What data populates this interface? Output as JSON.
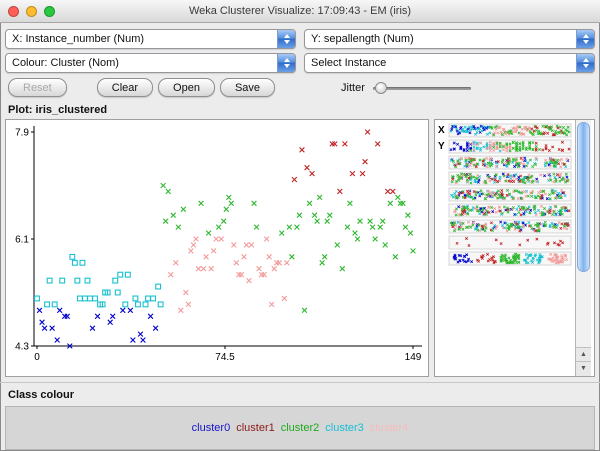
{
  "window": {
    "title": "Weka Clusterer Visualize: 17:09:43 - EM (iris)"
  },
  "controls": {
    "x_select": "X: Instance_number (Num)",
    "y_select": "Y: sepallength (Num)",
    "colour_select": "Colour: Cluster (Nom)",
    "instance_select": "Select Instance",
    "reset_label": "Reset",
    "clear_label": "Clear",
    "open_label": "Open",
    "save_label": "Save",
    "jitter_label": "Jitter"
  },
  "plot": {
    "label": "Plot: iris_clustered"
  },
  "attribute_panel": {
    "x_marker": "X",
    "y_marker": "Y",
    "strip_count": 9
  },
  "legend": {
    "title": "Class colour",
    "items": [
      {
        "label": "cluster0",
        "color": "#1414cc"
      },
      {
        "label": "cluster1",
        "color": "#8b1a1a"
      },
      {
        "label": "cluster2",
        "color": "#1faa1f"
      },
      {
        "label": "cluster3",
        "color": "#19bdd6"
      },
      {
        "label": "cluster4",
        "color": "#f7bcbc"
      }
    ]
  },
  "chart_data": {
    "type": "scatter",
    "title": "iris_clustered",
    "x_attribute": "Instance_number",
    "y_attribute": "sepallength",
    "xlim": [
      0,
      149
    ],
    "ylim": [
      4.3,
      7.9
    ],
    "x_ticks": [
      "0",
      "74.5",
      "149"
    ],
    "y_ticks": [
      "7.9",
      "6.1",
      "4.3"
    ],
    "grid": false,
    "legend_position": "bottom",
    "series": [
      {
        "name": "cluster0",
        "color": "#0000cc",
        "marker": "x",
        "points": [
          [
            1,
            4.9
          ],
          [
            2,
            4.7
          ],
          [
            3,
            4.6
          ],
          [
            6,
            4.6
          ],
          [
            8,
            4.4
          ],
          [
            9,
            4.9
          ],
          [
            11,
            4.8
          ],
          [
            12,
            4.8
          ],
          [
            13,
            4.3
          ],
          [
            22,
            4.6
          ],
          [
            24,
            4.8
          ],
          [
            29,
            4.7
          ],
          [
            30,
            4.8
          ],
          [
            34,
            4.9
          ],
          [
            37,
            4.9
          ],
          [
            38,
            4.4
          ],
          [
            41,
            4.5
          ],
          [
            42,
            4.4
          ],
          [
            45,
            4.8
          ],
          [
            47,
            4.6
          ]
        ]
      },
      {
        "name": "cluster1",
        "color": "#c32222",
        "marker": "x",
        "points": [
          [
            102,
            7.1
          ],
          [
            105,
            7.6
          ],
          [
            107,
            7.3
          ],
          [
            109,
            7.2
          ],
          [
            117,
            7.7
          ],
          [
            118,
            7.7
          ],
          [
            120,
            6.9
          ],
          [
            122,
            7.7
          ],
          [
            125,
            7.2
          ],
          [
            129,
            7.2
          ],
          [
            130,
            7.4
          ],
          [
            131,
            7.9
          ],
          [
            135,
            7.7
          ],
          [
            139,
            6.9
          ],
          [
            141,
            6.9
          ]
        ]
      },
      {
        "name": "cluster2",
        "color": "#2db82d",
        "marker": "x",
        "points": [
          [
            50,
            7.0
          ],
          [
            51,
            6.4
          ],
          [
            52,
            6.9
          ],
          [
            54,
            6.5
          ],
          [
            56,
            6.3
          ],
          [
            58,
            6.6
          ],
          [
            65,
            6.7
          ],
          [
            68,
            6.2
          ],
          [
            72,
            6.3
          ],
          [
            74,
            6.4
          ],
          [
            75,
            6.6
          ],
          [
            76,
            6.8
          ],
          [
            77,
            6.7
          ],
          [
            86,
            6.7
          ],
          [
            87,
            6.3
          ],
          [
            97,
            6.2
          ],
          [
            100,
            6.3
          ],
          [
            101,
            5.8
          ],
          [
            103,
            6.3
          ],
          [
            104,
            6.5
          ],
          [
            106,
            4.9
          ],
          [
            108,
            6.7
          ],
          [
            110,
            6.5
          ],
          [
            111,
            6.4
          ],
          [
            112,
            6.8
          ],
          [
            113,
            5.7
          ],
          [
            114,
            5.8
          ],
          [
            115,
            6.4
          ],
          [
            116,
            6.5
          ],
          [
            119,
            6.0
          ],
          [
            121,
            5.6
          ],
          [
            123,
            6.3
          ],
          [
            124,
            6.7
          ],
          [
            126,
            6.2
          ],
          [
            127,
            6.1
          ],
          [
            128,
            6.4
          ],
          [
            132,
            6.4
          ],
          [
            133,
            6.3
          ],
          [
            134,
            6.1
          ],
          [
            136,
            6.3
          ],
          [
            137,
            6.4
          ],
          [
            138,
            6.0
          ],
          [
            140,
            6.7
          ],
          [
            142,
            5.8
          ],
          [
            143,
            6.8
          ],
          [
            144,
            6.7
          ],
          [
            145,
            6.7
          ],
          [
            146,
            6.3
          ],
          [
            147,
            6.5
          ],
          [
            148,
            6.2
          ],
          [
            149,
            5.9
          ]
        ]
      },
      {
        "name": "cluster3",
        "color": "#18c0cf",
        "marker": "square",
        "points": [
          [
            0,
            5.1
          ],
          [
            4,
            5.0
          ],
          [
            5,
            5.4
          ],
          [
            7,
            5.0
          ],
          [
            10,
            5.4
          ],
          [
            14,
            5.8
          ],
          [
            15,
            5.7
          ],
          [
            16,
            5.4
          ],
          [
            17,
            5.1
          ],
          [
            18,
            5.7
          ],
          [
            19,
            5.1
          ],
          [
            20,
            5.4
          ],
          [
            21,
            5.1
          ],
          [
            23,
            5.1
          ],
          [
            25,
            5.0
          ],
          [
            26,
            5.0
          ],
          [
            27,
            5.2
          ],
          [
            28,
            5.2
          ],
          [
            31,
            5.4
          ],
          [
            32,
            5.2
          ],
          [
            33,
            5.5
          ],
          [
            35,
            5.0
          ],
          [
            36,
            5.5
          ],
          [
            39,
            5.1
          ],
          [
            40,
            5.0
          ],
          [
            43,
            5.0
          ],
          [
            44,
            5.1
          ],
          [
            46,
            5.1
          ],
          [
            48,
            5.3
          ],
          [
            49,
            5.0
          ]
        ]
      },
      {
        "name": "cluster4",
        "color": "#f29a9a",
        "marker": "x",
        "points": [
          [
            53,
            5.5
          ],
          [
            55,
            5.7
          ],
          [
            57,
            4.9
          ],
          [
            59,
            5.2
          ],
          [
            60,
            5.0
          ],
          [
            61,
            5.9
          ],
          [
            62,
            6.0
          ],
          [
            63,
            6.1
          ],
          [
            64,
            5.6
          ],
          [
            66,
            5.6
          ],
          [
            67,
            5.8
          ],
          [
            69,
            5.6
          ],
          [
            70,
            5.9
          ],
          [
            71,
            6.1
          ],
          [
            73,
            6.1
          ],
          [
            78,
            6.0
          ],
          [
            79,
            5.7
          ],
          [
            80,
            5.5
          ],
          [
            81,
            5.5
          ],
          [
            82,
            5.8
          ],
          [
            83,
            6.0
          ],
          [
            84,
            5.4
          ],
          [
            85,
            6.0
          ],
          [
            88,
            5.6
          ],
          [
            89,
            5.5
          ],
          [
            90,
            5.5
          ],
          [
            91,
            6.1
          ],
          [
            92,
            5.8
          ],
          [
            93,
            5.0
          ],
          [
            94,
            5.6
          ],
          [
            95,
            5.7
          ],
          [
            96,
            5.7
          ],
          [
            98,
            5.1
          ],
          [
            99,
            5.7
          ]
        ]
      }
    ]
  }
}
